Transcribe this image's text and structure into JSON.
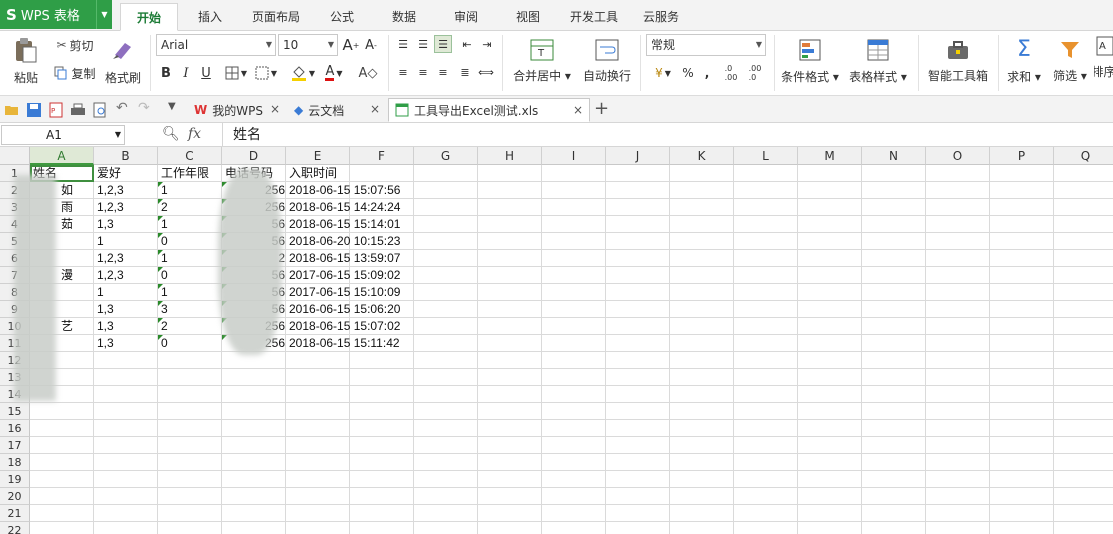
{
  "app": {
    "brand": "WPS 表格",
    "brand_logo": "S"
  },
  "menu": {
    "tabs": [
      "开始",
      "插入",
      "页面布局",
      "公式",
      "数据",
      "审阅",
      "视图",
      "开发工具",
      "云服务"
    ],
    "active": "开始"
  },
  "ribbon": {
    "paste": "粘贴",
    "cut": "剪切",
    "copy": "复制",
    "format_painter": "格式刷",
    "font_name": "Arial",
    "font_size": "10",
    "bold": "B",
    "italic": "I",
    "underline": "U",
    "merge_center": "合并居中",
    "wrap_text": "自动换行",
    "number_format": "常规",
    "percent": "%",
    "comma": ",",
    "inc_decimal": ".0\n.00",
    "dec_decimal": ".00\n.0",
    "conditional_format": "条件格式",
    "table_style": "表格样式",
    "smart_toolbox": "智能工具箱",
    "sum": "求和",
    "filter": "筛选",
    "sort": "排序",
    "font_grow": "A",
    "font_shrink": "A"
  },
  "doc_tabs": [
    {
      "label": "我的WPS",
      "icon": "wps-w-icon"
    },
    {
      "label": "云文档",
      "icon": "cloud-cube-icon"
    },
    {
      "label": "工具导出Excel测试.xls",
      "icon": "sheet-icon",
      "active": true
    }
  ],
  "formula_bar": {
    "cell_ref": "A1",
    "fx": "fx",
    "content": "姓名"
  },
  "sheet": {
    "columns": [
      "A",
      "B",
      "C",
      "D",
      "E",
      "F",
      "G",
      "H",
      "I",
      "J",
      "K",
      "L",
      "M",
      "N",
      "O",
      "P",
      "Q"
    ],
    "row_numbers": [
      "1",
      "2",
      "3",
      "4",
      "5",
      "6",
      "7",
      "8",
      "9",
      "10",
      "11",
      "12",
      "13",
      "14",
      "15",
      "16",
      "17",
      "18",
      "19",
      "20",
      "21",
      "22"
    ],
    "header_row": [
      "姓名",
      "爱好",
      "工作年限",
      "电话号码",
      "入职时间"
    ],
    "rows": [
      {
        "a": "如",
        "b": "1,2,3",
        "c": "1",
        "d": "256",
        "e": "2018-06-15 15:07:56"
      },
      {
        "a": "雨",
        "b": "1,2,3",
        "c": "2",
        "d": "256",
        "e": "2018-06-15 14:24:24"
      },
      {
        "a": "茹",
        "b": "1,3",
        "c": "1",
        "d": "56",
        "e": "2018-06-15 15:14:01"
      },
      {
        "a": "",
        "b": "1",
        "c": "0",
        "d": "56",
        "e": "2018-06-20 10:15:23"
      },
      {
        "a": "",
        "b": "1,2,3",
        "c": "1",
        "d": "2",
        "e": "2018-06-15 13:59:07"
      },
      {
        "a": "漫",
        "b": "1,2,3",
        "c": "0",
        "d": "56",
        "e": "2017-06-15 15:09:02"
      },
      {
        "a": "",
        "b": "1",
        "c": "1",
        "d": "56",
        "e": "2017-06-15 15:10:09"
      },
      {
        "a": "",
        "b": "1,3",
        "c": "3",
        "d": "56",
        "e": "2016-06-15 15:06:20"
      },
      {
        "a": "艺",
        "b": "1,3",
        "c": "2",
        "d": "256",
        "e": "2018-06-15 15:07:02"
      },
      {
        "a": "",
        "b": "1,3",
        "c": "0",
        "d": "256",
        "e": "2018-06-15 15:11:42"
      }
    ]
  },
  "colors": {
    "brand_green": "#2f9e47",
    "active_tab_text": "#1b7b35",
    "selection": "#3f8f3f"
  }
}
